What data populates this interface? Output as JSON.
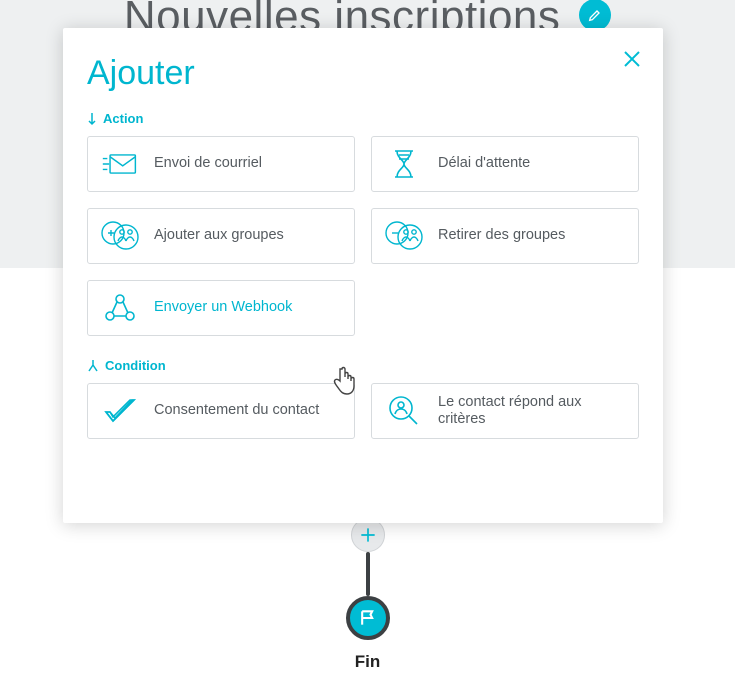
{
  "colors": {
    "accent": "#00bcd4"
  },
  "background": {
    "title": "Nouvelles inscriptions",
    "flow_end_label": "Fin"
  },
  "modal": {
    "title": "Ajouter",
    "close_label": "Fermer",
    "sections": {
      "action": {
        "header": "Action",
        "items": {
          "send_email": "Envoi de courriel",
          "delay": "Délai d'attente",
          "add_groups": "Ajouter aux groupes",
          "remove_groups": "Retirer des groupes",
          "webhook": "Envoyer un Webhook"
        }
      },
      "condition": {
        "header": "Condition",
        "items": {
          "consent": "Consentement du contact",
          "criteria": "Le contact répond aux critères"
        }
      }
    }
  }
}
